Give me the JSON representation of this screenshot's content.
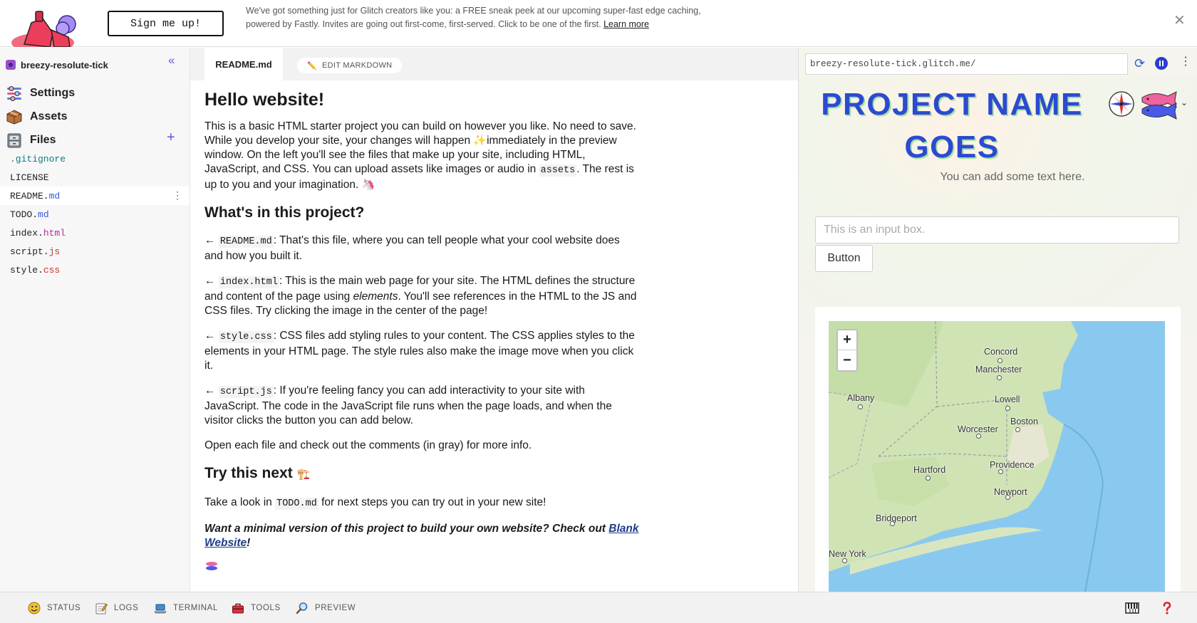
{
  "banner": {
    "signup_label": "Sign me up!",
    "message": "We've got something just for Glitch creators like you: a FREE sneak peek at our upcoming super-fast edge caching, powered by Fastly. Invites are going out first-come, first-served. Click to be one of the first.",
    "learn_more": "Learn more",
    "close_icon": "close-icon"
  },
  "sidebar": {
    "project_name": "breezy-resolute-tick",
    "nav": [
      {
        "label": "Settings",
        "icon": "settings-icon"
      },
      {
        "label": "Assets",
        "icon": "assets-box-icon"
      },
      {
        "label": "Files",
        "icon": "files-cabinet-icon"
      }
    ],
    "files": [
      {
        "base": ".gitignore",
        "ext": ""
      },
      {
        "base": "LICENSE",
        "ext": ""
      },
      {
        "base": "README.",
        "ext": "md"
      },
      {
        "base": "TODO.",
        "ext": "md"
      },
      {
        "base": "index.",
        "ext": "html"
      },
      {
        "base": "script.",
        "ext": "js"
      },
      {
        "base": "style.",
        "ext": "css"
      }
    ],
    "active_file": "README.md"
  },
  "editor": {
    "tab_label": "README.md",
    "edit_markdown_label": "EDIT MARKDOWN",
    "h1": "Hello website!",
    "intro_a": "This is a basic HTML starter project you can build on however you like. No need to save. While you develop your site, your changes will happen ",
    "intro_b": "immediately in the preview window. On the left you'll see the files that make up your site, including HTML, JavaScript, and CSS. You can upload assets like images or audio in ",
    "intro_code": "assets",
    "intro_c": ". The rest is up to you and your imagination. ",
    "h2_project": "What's in this project?",
    "arrow": "←",
    "items": [
      {
        "code": "README.md",
        "text": ": That's this file, where you can tell people what your cool website does and how you built it."
      },
      {
        "code": "index.html",
        "text_a": ": This is the main web page for your site. The HTML defines the structure and content of the page using ",
        "em": "elements",
        "text_b": ". You'll see references in the HTML to the JS and CSS files. Try clicking the image in the center of the page!"
      },
      {
        "code": "style.css",
        "text": ": CSS files add styling rules to your content. The CSS applies styles to the elements in your HTML page. The style rules also make the image move when you click it."
      },
      {
        "code": "script.js",
        "text": ": If you're feeling fancy you can add interactivity to your site with JavaScript. The code in the JavaScript file runs when the page loads, and when the visitor clicks the button you can add below."
      }
    ],
    "open_each": "Open each file and check out the comments (in gray) for more info.",
    "h2_next": "Try this next",
    "take_look_a": "Take a look in ",
    "take_look_code": "TODO.md",
    "take_look_b": " for next steps you can try out in your new site!",
    "minimal_a": "Want a minimal version of this project to build your own website? Check out ",
    "minimal_link": "Blank Website",
    "minimal_b": "!"
  },
  "preview": {
    "url": "breezy-resolute-tick.glitch.me/",
    "site_title": "PROJECT NAME GOES",
    "site_subtitle": "You can add some text here.",
    "input_placeholder": "This is an input box.",
    "button_label": "Button",
    "zoom_in": "+",
    "zoom_out": "−",
    "cities": [
      "Concord",
      "Manchester",
      "Albany",
      "Lowell",
      "Boston",
      "Worcester",
      "Hartford",
      "Providence",
      "Newport",
      "Bridgeport",
      "New York"
    ],
    "colors": {
      "title": "#2c4ad1",
      "title_shadow": "#a4e0a0",
      "water": "#8ac9ef",
      "land": "#cfe3b4"
    }
  },
  "bottom_bar": {
    "items": [
      {
        "label": "STATUS",
        "icon": "smiley-status-icon"
      },
      {
        "label": "LOGS",
        "icon": "logs-notepad-icon"
      },
      {
        "label": "TERMINAL",
        "icon": "terminal-laptop-icon"
      },
      {
        "label": "TOOLS",
        "icon": "toolbox-icon"
      },
      {
        "label": "PREVIEW",
        "icon": "magnifier-preview-icon"
      }
    ],
    "right_icons": [
      "keyboard-piano-icon",
      "help-question-icon"
    ]
  }
}
